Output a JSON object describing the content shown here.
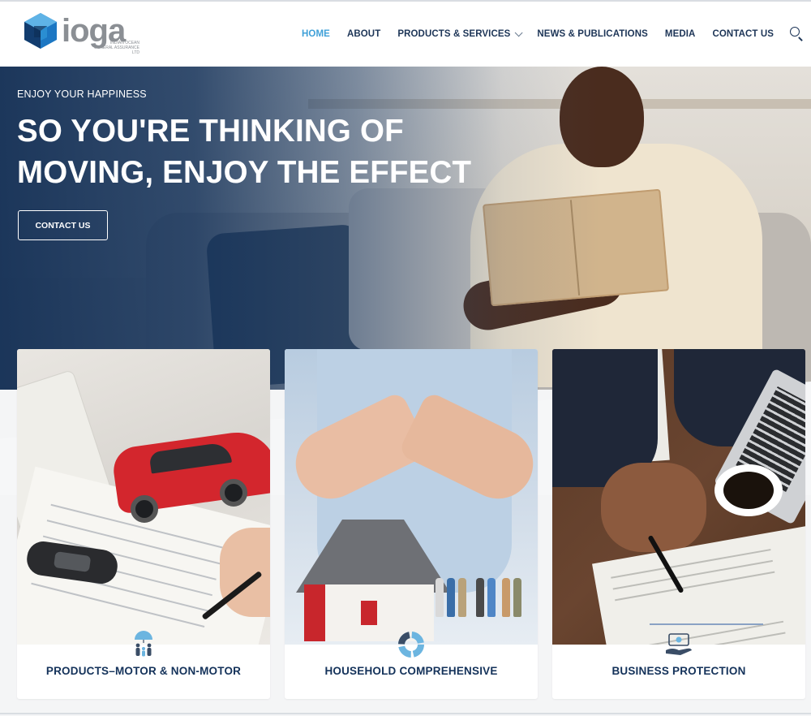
{
  "header": {
    "logo_text": "ioga",
    "logo_subtext": "INDIAN OCEAN GENERAL ASSURANCE LTD",
    "nav": [
      {
        "label": "HOME",
        "active": true
      },
      {
        "label": "ABOUT",
        "active": false
      },
      {
        "label": "PRODUCTS & SERVICES",
        "active": false,
        "has_dropdown": true
      },
      {
        "label": "NEWS & PUBLICATIONS",
        "active": false
      },
      {
        "label": "MEDIA",
        "active": false
      },
      {
        "label": "CONTACT US",
        "active": false
      }
    ],
    "search_icon": "search-icon"
  },
  "hero": {
    "tagline": "ENJOY YOUR HAPPINESS",
    "title": "SO YOU'RE THINKING OF MOVING, ENJOY THE EFFECT",
    "button_label": "CONTACT US"
  },
  "cards": [
    {
      "title": "PRODUCTS–MOTOR & NON-MOTOR",
      "icon": "family-umbrella-icon"
    },
    {
      "title": "HOUSEHOLD COMPREHENSIVE",
      "icon": "ring-segments-icon"
    },
    {
      "title": "BUSINESS PROTECTION",
      "icon": "money-hand-icon"
    }
  ],
  "colors": {
    "brand_navy": "#14325a",
    "nav_active": "#3fa0d8",
    "hero_overlay": "#143056",
    "logo_blue": "#1c77c3"
  }
}
